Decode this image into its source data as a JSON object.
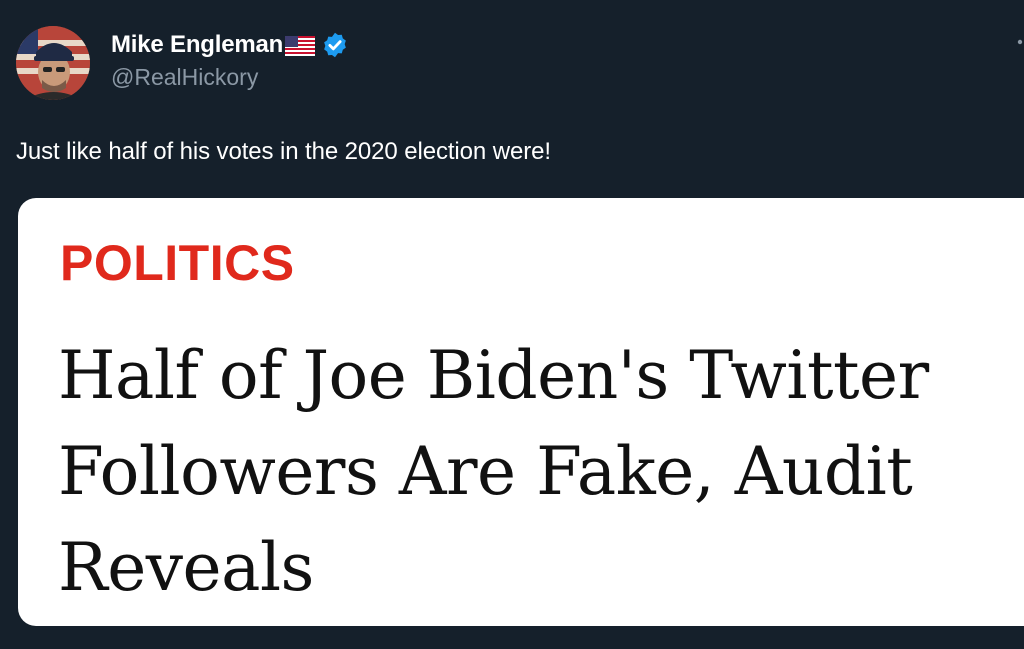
{
  "author": {
    "display_name": "Mike Engleman",
    "handle": "@RealHickory",
    "flag_icon": "us-flag-icon",
    "verified_icon": "verified-badge-icon"
  },
  "tweet": {
    "text": "Just like half of his votes in the 2020 election were!"
  },
  "card": {
    "category": "POLITICS",
    "headline": "Half of Joe Biden's Twitter Followers Are Fake, Audit Reveals"
  },
  "colors": {
    "background": "#15202b",
    "text_primary": "#ffffff",
    "text_secondary": "#8b98a5",
    "verified_blue": "#1d9bf0",
    "category_red": "#e0291c"
  }
}
